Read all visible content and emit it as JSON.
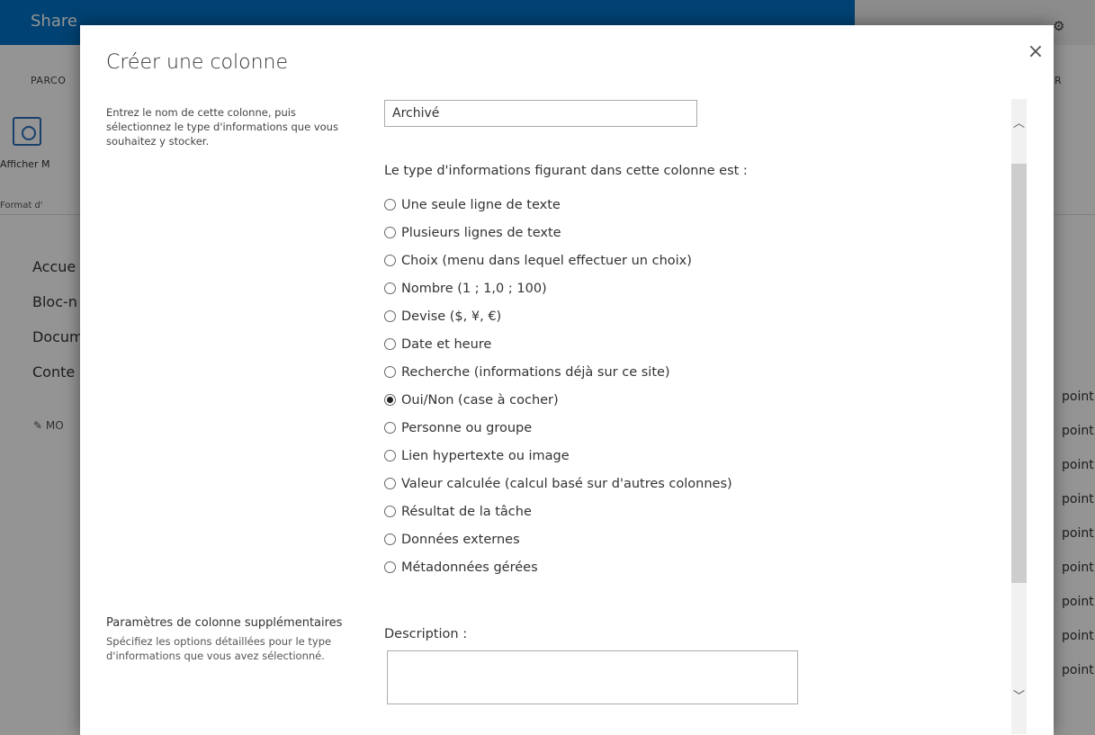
{
  "background": {
    "suite_title": "Share",
    "ribbon_tab": "PARCO",
    "ribbon_tab_right": "R",
    "ribbon_button": "Afficher  M",
    "ribbon_group": "Format d'",
    "nav": [
      "Accue",
      "Bloc-n",
      "Docum",
      "Conte"
    ],
    "nav_edit": "MO",
    "doc_rows": [
      "point",
      "point",
      "point",
      "point",
      "point",
      "point",
      "point",
      "point",
      "point"
    ]
  },
  "dialog": {
    "title": "Créer une colonne",
    "close_label": "×",
    "left_description": "Entrez le nom de cette colonne, puis sélectionnez le type d'informations que vous souhaitez y stocker.",
    "column_name_value": "Archivé",
    "type_label": "Le type d'informations figurant dans cette colonne est :",
    "types": [
      {
        "label": "Une seule ligne de texte",
        "checked": false
      },
      {
        "label": "Plusieurs lignes de texte",
        "checked": false
      },
      {
        "label": "Choix (menu dans lequel effectuer un choix)",
        "checked": false
      },
      {
        "label": "Nombre (1 ; 1,0 ; 100)",
        "checked": false
      },
      {
        "label": "Devise ($, ¥, €)",
        "checked": false
      },
      {
        "label": "Date et heure",
        "checked": false
      },
      {
        "label": "Recherche (informations déjà sur ce site)",
        "checked": false
      },
      {
        "label": "Oui/Non (case à cocher)",
        "checked": true
      },
      {
        "label": "Personne ou groupe",
        "checked": false
      },
      {
        "label": "Lien hypertexte ou image",
        "checked": false
      },
      {
        "label": "Valeur calculée (calcul basé sur d'autres colonnes)",
        "checked": false
      },
      {
        "label": "Résultat de la tâche",
        "checked": false
      },
      {
        "label": "Données externes",
        "checked": false
      },
      {
        "label": "Métadonnées gérées",
        "checked": false
      }
    ],
    "additional_settings_heading": "Paramètres de colonne supplémentaires",
    "additional_settings_desc": "Spécifiez les options détaillées pour le type d'informations que vous avez sélectionné.",
    "description_label": "Description :",
    "description_value": ""
  },
  "colors": {
    "suitebar": "#0072c6",
    "overlay": "rgba(0,0,0,0.42)"
  }
}
